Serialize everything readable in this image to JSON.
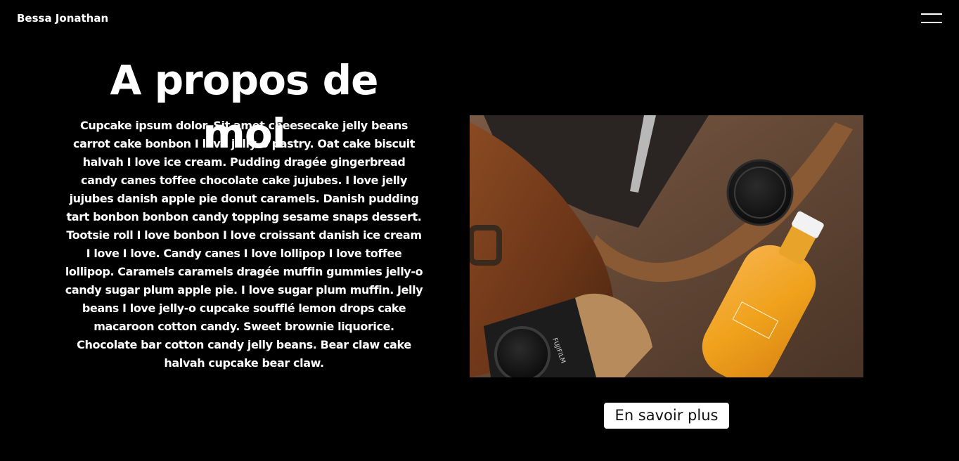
{
  "header": {
    "brand": "Bessa Jonathan",
    "menu_icon": "hamburger-menu-icon"
  },
  "about": {
    "title": "A propos de moi",
    "text": "Cupcake ipsum dolor. Sit amet cheesecake jelly beans carrot cake bonbon I love jelly-o pastry. Oat cake biscuit halvah I love ice cream. Pudding dragée gingerbread candy canes toffee chocolate cake jujubes. I love jelly jujubes danish apple pie donut caramels. Danish pudding tart bonbon bonbon candy topping sesame snaps dessert. Tootsie roll I love bonbon I love croissant danish ice cream I love I love. Candy canes I love lollipop I love toffee lollipop. Caramels caramels dragée muffin gummies jelly-o candy sugar plum apple pie. I love sugar plum muffin. Jelly beans I love jelly-o cupcake soufflé lemon drops cake macaroon cotton candy. Sweet brownie liquorice. Chocolate bar cotton candy jelly beans. Bear claw cake halvah cupcake bear claw.",
    "button_label": "En savoir plus"
  },
  "photo": {
    "camera_brand_text": "FUJIFILM"
  },
  "colors": {
    "background": "#000000",
    "text": "#ffffff",
    "button_bg": "#ffffff",
    "button_text": "#111111"
  }
}
